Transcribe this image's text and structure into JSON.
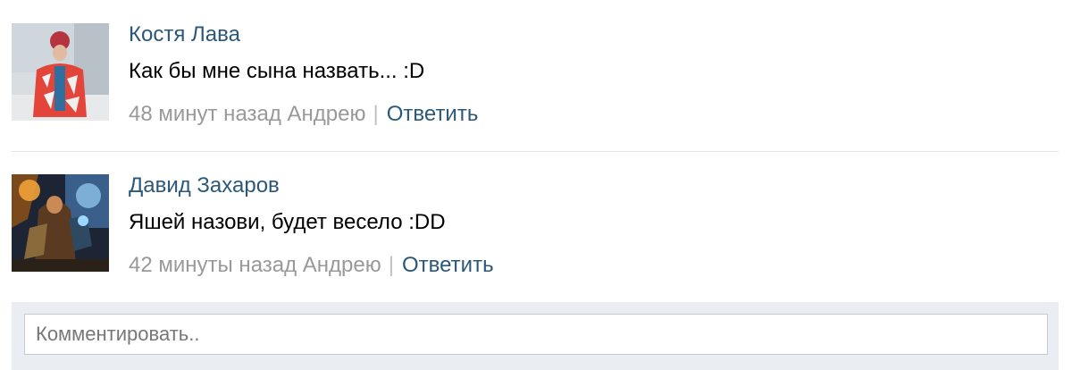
{
  "comments": [
    {
      "author": "Костя Лава",
      "text": "Как бы мне сына назвать... :D",
      "time": "48 минут назад Андрею",
      "separator": "|",
      "reply_label": "Ответить",
      "avatar_icon": "user-photo-avatar"
    },
    {
      "author": "Давид Захаров",
      "text": "Яшей назови, будет весело :DD",
      "time": "42 минуты назад Андрею",
      "separator": "|",
      "reply_label": "Ответить",
      "avatar_icon": "game-art-avatar"
    }
  ],
  "composer": {
    "placeholder": "Комментировать.."
  },
  "colors": {
    "link": "#2b587a",
    "meta": "#999999",
    "composer_bg": "#eaedf1",
    "input_border": "#c0cad5"
  }
}
